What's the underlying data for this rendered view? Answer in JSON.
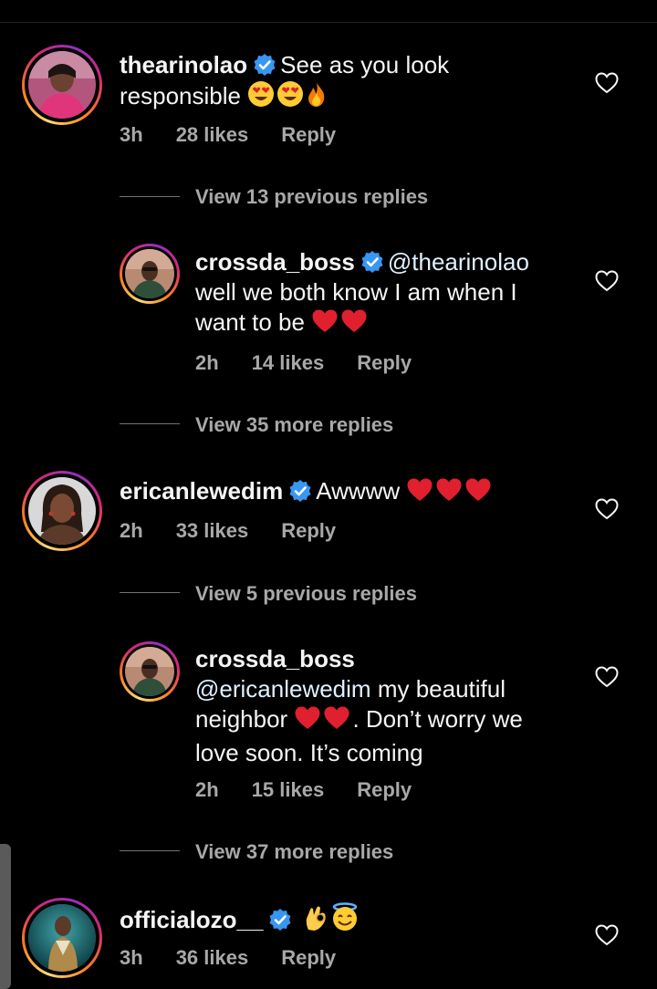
{
  "comments": [
    {
      "username": "thearinolao",
      "text": "See as you look responsible",
      "emojis": [
        "heart-eyes",
        "heart-eyes",
        "fire"
      ],
      "time": "3h",
      "likes": "28 likes",
      "reply": "Reply",
      "view_replies": "View 13 previous replies"
    },
    {
      "username": "crossda_boss",
      "mention": "@thearinolao",
      "text_line1": "well we both know I am when I",
      "text_line2": "want to be",
      "emojis": [
        "red-heart",
        "red-heart"
      ],
      "time": "2h",
      "likes": "14 likes",
      "reply": "Reply",
      "view_replies": "View 35 more replies"
    },
    {
      "username": "ericanlewedim",
      "text": "Awwww",
      "emojis": [
        "red-heart",
        "red-heart",
        "red-heart"
      ],
      "time": "2h",
      "likes": "33 likes",
      "reply": "Reply",
      "view_replies": "View 5 previous replies"
    },
    {
      "username": "crossda_boss",
      "mention": "@ericanlewedim",
      "text_after_mention": "my beautiful",
      "text_line2_a": "neighbor",
      "text_line2_b": ". Don’t worry we",
      "text_line3": "love soon. It’s coming",
      "emojis": [
        "red-heart",
        "red-heart"
      ],
      "time": "2h",
      "likes": "15 likes",
      "reply": "Reply",
      "view_replies": "View 37 more replies"
    },
    {
      "username": "officialozo__",
      "emojis": [
        "ok-hand",
        "smiling-face-with-halo"
      ],
      "time": "3h",
      "likes": "36 likes",
      "reply": "Reply"
    }
  ],
  "colors": {
    "background": "#000000",
    "verified": "#3897f0",
    "secondary_text": "#a8a8a8",
    "heart_emoji": "#e0202e"
  }
}
